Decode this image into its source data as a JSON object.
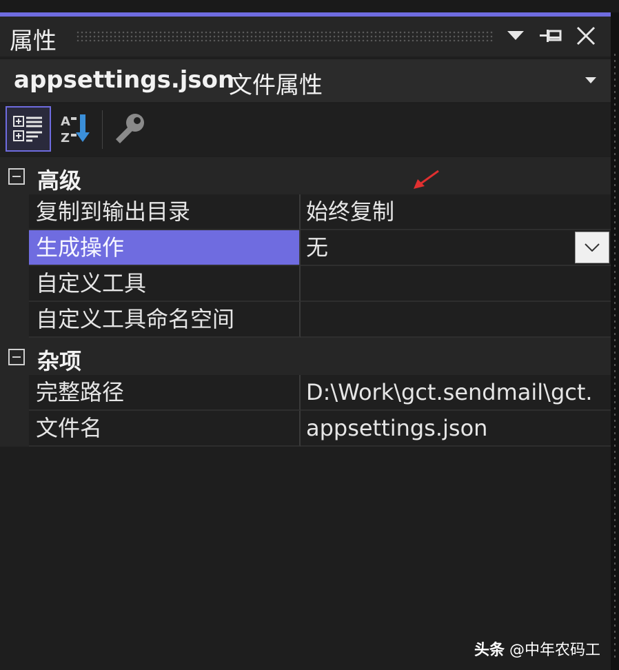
{
  "window": {
    "title": "属性",
    "icons": {
      "dropdown": "chevron-down-icon",
      "pin": "pin-icon",
      "close": "close-icon"
    }
  },
  "header": {
    "file_name": "appsettings.json",
    "file_type": "文件属性"
  },
  "toolbar": {
    "buttons": [
      "categorized-icon",
      "alphabetical-icon",
      "property-pages-wrench-icon"
    ]
  },
  "categories": [
    {
      "label": "高级",
      "properties": [
        {
          "name": "复制到输出目录",
          "value": "始终复制"
        },
        {
          "name": "生成操作",
          "value": "无",
          "selected": true
        },
        {
          "name": "自定义工具",
          "value": ""
        },
        {
          "name": "自定义工具命名空间",
          "value": ""
        }
      ]
    },
    {
      "label": "杂项",
      "properties": [
        {
          "name": "完整路径",
          "value": "D:\\Work\\gct.sendmail\\gct."
        },
        {
          "name": "文件名",
          "value": "appsettings.json"
        }
      ]
    }
  ],
  "watermark": {
    "brand": "头条",
    "handle": "@中年农码工"
  },
  "colors": {
    "accent": "#6f6ce0",
    "background": "#1e1e1e",
    "annotation_arrow": "#e03030"
  }
}
